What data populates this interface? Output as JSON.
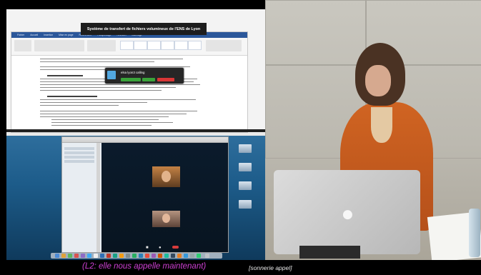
{
  "presentation": {
    "title": "Système de transfert de fichiers volumineux de l'ENS de Lyon"
  },
  "word": {
    "tabs": [
      "Fichier",
      "Accueil",
      "Insertion",
      "Mise en page",
      "Références",
      "Publipostage",
      "Révision",
      "Affichage"
    ]
  },
  "skype_popup": {
    "title": "elsa lyon3 calling"
  },
  "subtitles": {
    "speech": "(L2: elle nous appelle maintenant)",
    "note": "[sonnerie appel]"
  },
  "colors": {
    "speech_text": "#cc3fd1",
    "note_text": "#e8e8e8",
    "answer_button": "#3aa33a",
    "decline_button": "#d93636",
    "sweater": "#d06422"
  },
  "icons": {
    "apple_logo": "apple-logo-icon",
    "hangup": "phone-hangup-icon",
    "mic": "microphone-icon",
    "video": "video-camera-icon"
  }
}
